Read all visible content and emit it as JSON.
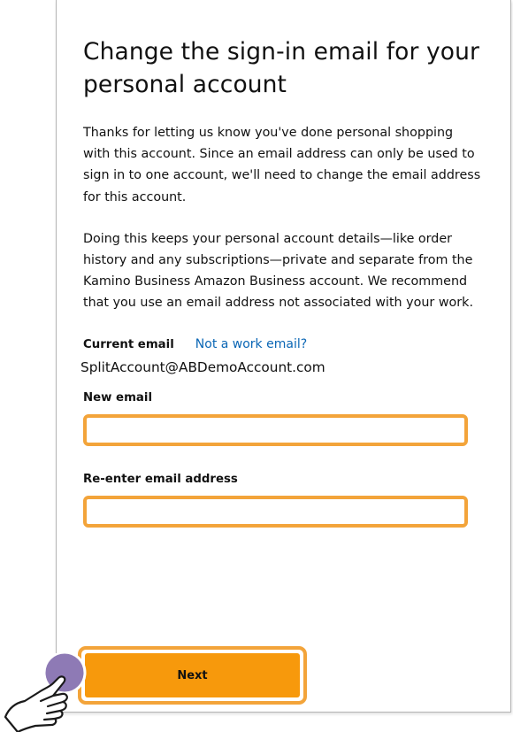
{
  "page": {
    "title": "Change the sign-in email for your personal account",
    "paragraph_1": "Thanks for letting us know you've done personal shopping with this account. Since an email address can only be used to sign in to one account, we'll need to change the email address for this account.",
    "paragraph_2": "Doing this keeps your personal account details—like order history and any subscriptions—private and separate from the Kamino Business Amazon Business account. We recommend that you use an email address not associated with your work."
  },
  "current_email": {
    "label": "Current email",
    "link": "Not a work email?",
    "value": "SplitAccount@ABDemoAccount.com"
  },
  "form": {
    "new_email_label": "New email",
    "new_email_value": "",
    "reenter_label": "Re-enter email address",
    "reenter_value": "",
    "next_label": "Next"
  },
  "colors": {
    "accent": "#f7990c",
    "highlight": "#f3a43a",
    "link": "#0a66b5",
    "cursor_dot": "#8e7ab5"
  },
  "icons": {
    "cursor": "pointer-hand-icon"
  }
}
